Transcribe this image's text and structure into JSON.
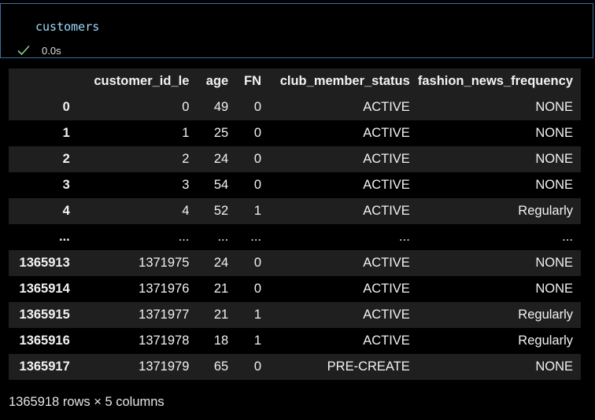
{
  "cell": {
    "code": "customers",
    "status_icon": "check-icon",
    "exec_time": "0.0s"
  },
  "table": {
    "columns": [
      "",
      "customer_id_le",
      "age",
      "FN",
      "club_member_status",
      "fashion_news_frequency"
    ],
    "rows": [
      [
        "0",
        "0",
        "49",
        "0",
        "ACTIVE",
        "NONE"
      ],
      [
        "1",
        "1",
        "25",
        "0",
        "ACTIVE",
        "NONE"
      ],
      [
        "2",
        "2",
        "24",
        "0",
        "ACTIVE",
        "NONE"
      ],
      [
        "3",
        "3",
        "54",
        "0",
        "ACTIVE",
        "NONE"
      ],
      [
        "4",
        "4",
        "52",
        "1",
        "ACTIVE",
        "Regularly"
      ],
      [
        "...",
        "...",
        "...",
        "...",
        "...",
        "..."
      ],
      [
        "1365913",
        "1371975",
        "24",
        "0",
        "ACTIVE",
        "NONE"
      ],
      [
        "1365914",
        "1371976",
        "21",
        "0",
        "ACTIVE",
        "NONE"
      ],
      [
        "1365915",
        "1371977",
        "21",
        "1",
        "ACTIVE",
        "Regularly"
      ],
      [
        "1365916",
        "1371978",
        "18",
        "1",
        "ACTIVE",
        "Regularly"
      ],
      [
        "1365917",
        "1371979",
        "65",
        "0",
        "PRE-CREATE",
        "NONE"
      ]
    ]
  },
  "summary": "1365918 rows × 5 columns",
  "colors": {
    "background": "#000000",
    "cell_border": "#3c6e9e",
    "code_text": "#9cdcfe",
    "row_stripe": "#1f1f1f",
    "success": "#89d185"
  }
}
